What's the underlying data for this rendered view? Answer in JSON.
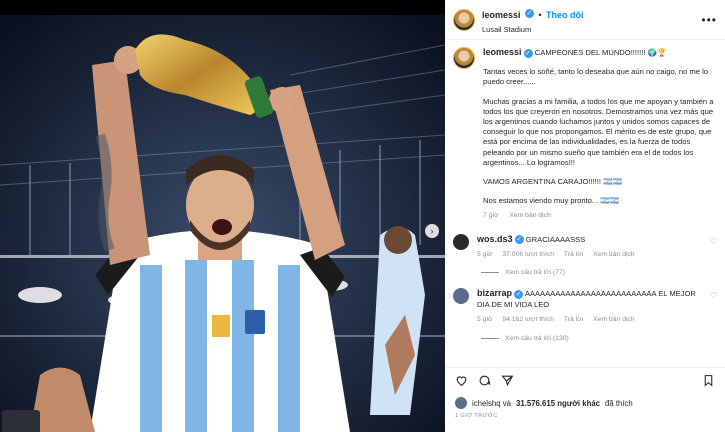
{
  "post": {
    "username": "leomessi",
    "follow_label": "Theo dõi",
    "location": "Lusail Stadium",
    "more_label": "•••"
  },
  "caption": {
    "username": "leomessi",
    "title": "CAMPEONES DEL MUNDO!!!!!!! 🌍🏆",
    "paragraphs": [
      "Tantas veces lo soñé, tanto lo deseaba que aún no caigo, no me lo puedo creer......",
      "Muchas gracias a mi familia, a todos los que me apoyan y también a todos los que creyeron en nosotros. Demostramos una vez más que los argentinos cuando luchamos juntos y unidos somos capaces de conseguir lo que nos propongamos. El mérito es de este grupo, que está por encima de las individualidades, es la fuerza de todos peleando por un mismo sueño que también era el de todos los argentinos... Lo logramos!!!",
      "VAMOS ARGENTINA CARAJO!!!!!! 🇦🇷🇦🇷",
      "Nos estamos viendo muy pronto... 🇦🇷🇦🇷"
    ],
    "time": "7 giờ",
    "translate": "Xem bản dịch"
  },
  "comments": [
    {
      "username": "wos.ds3",
      "text": "GRACIAAAASSS",
      "time": "5 giờ",
      "likes": "37.006 lượt thích",
      "reply": "Trả lời",
      "translate": "Xem bản dịch",
      "replies": "Xem câu trả lời (77)"
    },
    {
      "username": "bizarrap",
      "text": "AAAAAAAAAAAAAAAAAAAAAAAAAA EL MEJOR DIA DE MI VIDA LEO",
      "time": "5 giờ",
      "likes": "84.162 lượt thích",
      "reply": "Trả lời",
      "translate": "Xem bản dịch",
      "replies": "Xem câu trả lời (130)"
    }
  ],
  "likes": {
    "prefix": "ichelshq và",
    "count": "31.576.615 người khác",
    "suffix": "đã thích"
  },
  "timestamp": "1 GIỜ TRƯỚC",
  "colors": {
    "accent": "#0095f6",
    "verified": "#3897f0",
    "muted": "#8e8e8e"
  },
  "icons": [
    "more-icon",
    "heart-icon",
    "comment-icon",
    "share-icon",
    "bookmark-icon",
    "next-arrow-icon",
    "verified-icon"
  ]
}
